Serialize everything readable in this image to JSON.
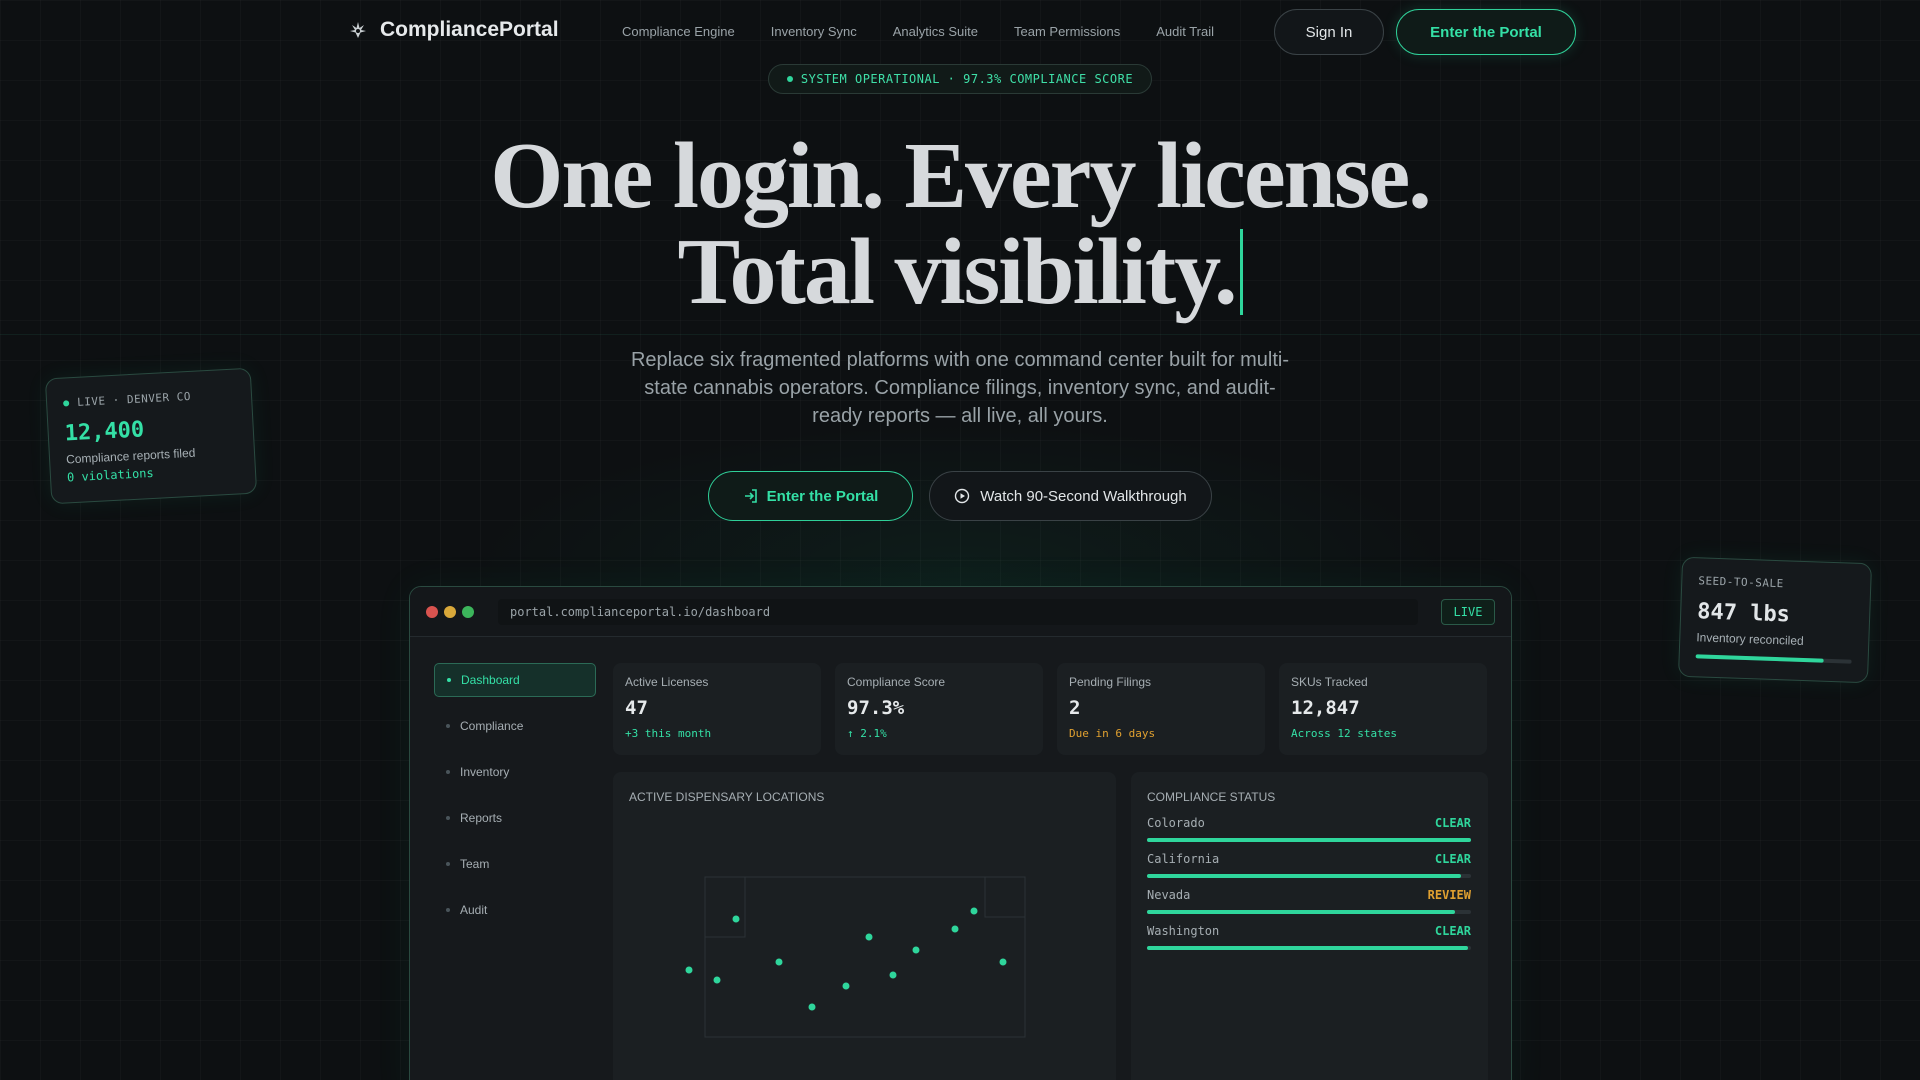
{
  "colors": {
    "accent": "#2fd69c",
    "review": "#e0a030",
    "background": "#0d1012"
  },
  "nav": {
    "brand": "CompliancePortal",
    "logo_icon": "cannabis-leaf-icon",
    "links": [
      "Compliance Engine",
      "Inventory Sync",
      "Analytics Suite",
      "Team Permissions",
      "Audit Trail"
    ],
    "sign_in": "Sign In",
    "enter": "Enter the Portal"
  },
  "status_pill": "SYSTEM OPERATIONAL · 97.3% COMPLIANCE SCORE",
  "hero": {
    "line1": "One login. Every license.",
    "line2": "Total visibility.",
    "subtitle": "Replace six fragmented platforms with one command center built for multi-state cannabis operators. Compliance filings, inventory sync, and audit-ready reports — all live, all yours.",
    "cta_primary": "Enter the Portal",
    "cta_secondary": "Watch 90-Second Walkthrough"
  },
  "left_card": {
    "label": "LIVE · DENVER CO",
    "value": "12,400",
    "desc": "Compliance reports filed",
    "note": "0 violations"
  },
  "right_card": {
    "label": "SEED-TO-SALE",
    "value": "847 lbs",
    "desc": "Inventory reconciled",
    "progress": 0.82
  },
  "window": {
    "url": "portal.complianceportal.io/dashboard",
    "live": "LIVE",
    "sidebar": [
      "Dashboard",
      "Compliance",
      "Inventory",
      "Reports",
      "Team",
      "Audit"
    ],
    "stats": [
      {
        "label": "Active Licenses",
        "value": "47",
        "sub": "+3 this month",
        "tone": "green"
      },
      {
        "label": "Compliance Score",
        "value": "97.3%",
        "sub": "↑ 2.1%",
        "tone": "green"
      },
      {
        "label": "Pending Filings",
        "value": "2",
        "sub": "Due in 6 days",
        "tone": "amber"
      },
      {
        "label": "SKUs Tracked",
        "value": "12,847",
        "sub": "Across 12 states",
        "tone": "green"
      }
    ],
    "map_title": "ACTIVE DISPENSARY LOCATIONS",
    "status_title": "COMPLIANCE STATUS",
    "compliance": [
      {
        "state": "Colorado",
        "status": "CLEAR",
        "level": 1.0
      },
      {
        "state": "California",
        "status": "CLEAR",
        "level": 0.97
      },
      {
        "state": "Nevada",
        "status": "REVIEW",
        "level": 0.95
      },
      {
        "state": "Washington",
        "status": "CLEAR",
        "level": 0.99
      }
    ]
  }
}
